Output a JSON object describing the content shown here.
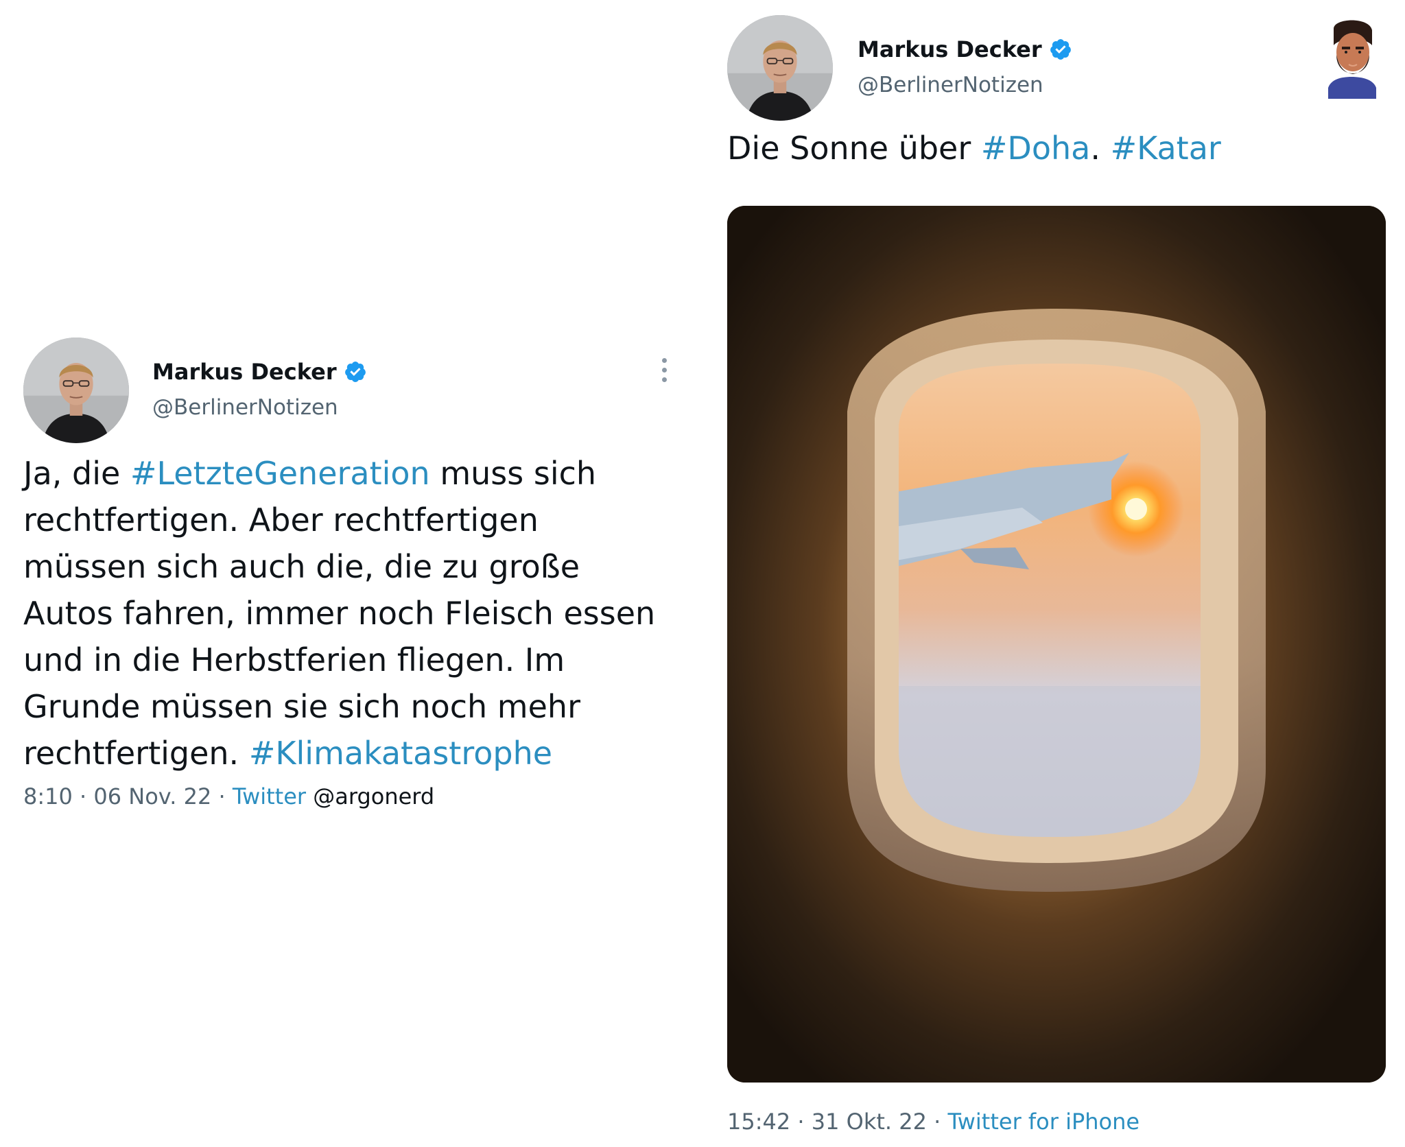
{
  "left_tweet": {
    "author_name": "Markus Decker",
    "author_handle": "@BerlinerNotizen",
    "verified": true,
    "text": {
      "t1": "Ja, die ",
      "h1": "#LetzteGeneration",
      "t2": " muss sich rechtfertigen. Aber rechtfertigen müssen sich auch die, die zu große Autos fahren, immer noch Fleisch essen und in die Herbstferien fliegen. Im Grunde müssen sie sich noch mehr rechtfertigen. ",
      "h2": "#Klimakatastrophe"
    },
    "time": "8:10",
    "date": "06 Nov. 22",
    "source": "Twitter",
    "credit": "@argonerd",
    "separator": "·"
  },
  "right_tweet": {
    "author_name": "Markus Decker",
    "author_handle": "@BerlinerNotizen",
    "verified": true,
    "text": {
      "t1": "Die Sonne über ",
      "h1": "#Doha",
      "t2": ". ",
      "h2": "#Katar"
    },
    "photo_icon": "airplane-window-sunset-photo",
    "time": "15:42",
    "date": "31 Okt. 22",
    "source": "Twitter for iPhone",
    "separator": "·"
  },
  "colors": {
    "hashtag": "#2b8ec0",
    "handle": "#536471",
    "verified": "#1d9bf0"
  }
}
